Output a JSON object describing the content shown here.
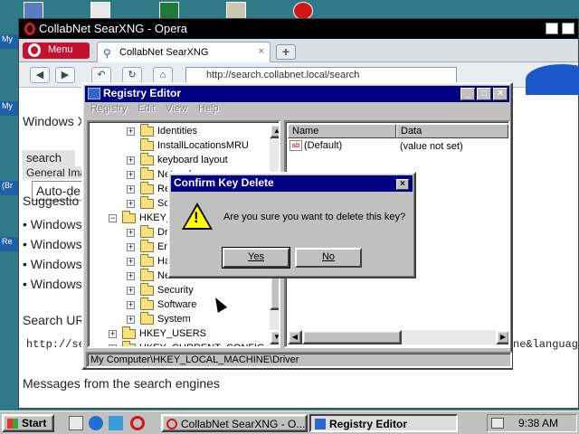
{
  "opera": {
    "window_title": "CollabNet SearXNG - Opera",
    "menu_label": "Menu",
    "tab_title": "CollabNet SearXNG",
    "tab_close": "×",
    "new_tab": "+",
    "address": "http://search.collabnet.local/search"
  },
  "page": {
    "line_windows": "Windows X",
    "search_button": "search",
    "general_label": "General Ima",
    "auto_field": "Auto-de",
    "suggestions": "Suggestio",
    "bullets": [
      "• Windows",
      "• Windows",
      "• Windows",
      "• Windows"
    ],
    "search_url_label": "Search UR",
    "url_snippet": "http://se",
    "url_tail": "ne&languag",
    "messages": "Messages from the search engines"
  },
  "regedit": {
    "title": "Registry Editor",
    "menu": [
      "Registry",
      "Edit",
      "View",
      "Help"
    ],
    "tree": [
      {
        "label": "Identities",
        "pm": "+",
        "indent": 2
      },
      {
        "label": "InstallLocationsMRU",
        "pm": "",
        "indent": 2
      },
      {
        "label": "keyboard layout",
        "pm": "+",
        "indent": 2
      },
      {
        "label": "Network",
        "pm": "+",
        "indent": 2
      },
      {
        "label": "Re",
        "pm": "+",
        "indent": 2
      },
      {
        "label": "Sof",
        "pm": "+",
        "indent": 2
      },
      {
        "label": "HKEY_L",
        "pm": "−",
        "indent": 1
      },
      {
        "label": "Dri",
        "pm": "+",
        "indent": 2
      },
      {
        "label": "Enu",
        "pm": "+",
        "indent": 2
      },
      {
        "label": "Har",
        "pm": "+",
        "indent": 2
      },
      {
        "label": "Net",
        "pm": "+",
        "indent": 2
      },
      {
        "label": "Security",
        "pm": "+",
        "indent": 2
      },
      {
        "label": "Software",
        "pm": "+",
        "indent": 2
      },
      {
        "label": "System",
        "pm": "+",
        "indent": 2
      },
      {
        "label": "HKEY_USERS",
        "pm": "+",
        "indent": 1
      },
      {
        "label": "HKEY_CURRENT_CONFIG",
        "pm": "+",
        "indent": 1
      }
    ],
    "columns": [
      "Name",
      "Data"
    ],
    "value_name": "(Default)",
    "value_data": "(value not set)",
    "status": "My Computer\\HKEY_LOCAL_MACHINE\\Driver"
  },
  "dialog": {
    "title": "Confirm Key Delete",
    "message": "Are you sure you want to delete this key?",
    "yes_label": "Yes",
    "no_label": "No",
    "close": "×"
  },
  "taskbar": {
    "start_label": "Start",
    "tasks": [
      "CollabNet SearXNG - O...",
      "Registry Editor"
    ],
    "clock": "9:38 AM"
  },
  "colors": {
    "titlebar_active": "#000080",
    "opera_red": "#c8102e",
    "desktop": "#2f7a86",
    "face": "#c0c0c0"
  }
}
